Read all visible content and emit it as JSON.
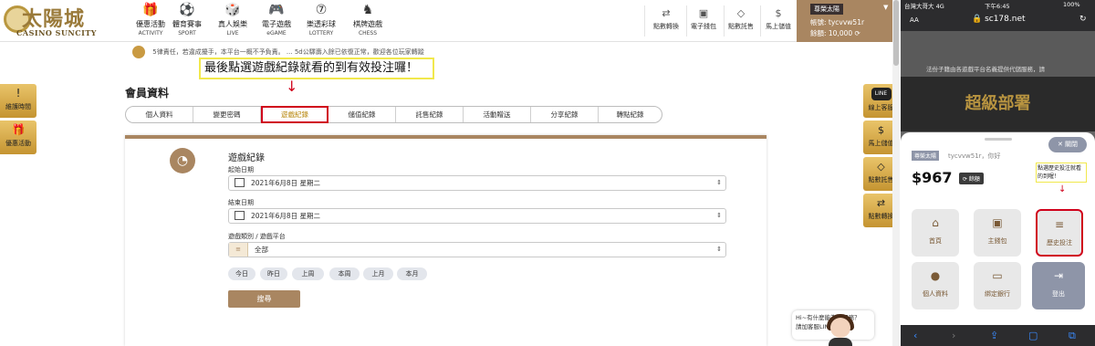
{
  "brand": {
    "name": "太陽城",
    "sub": "CASINO SUNCITY"
  },
  "nav": [
    {
      "icon": "gift-icon",
      "glyph": "🎁",
      "zh": "優惠活動",
      "en": "ACTIVITY"
    },
    {
      "icon": "soccer-icon",
      "glyph": "⚽",
      "zh": "體育賽事",
      "en": "SPORT"
    },
    {
      "icon": "dice-icon",
      "glyph": "🎲",
      "zh": "真人娛樂",
      "en": "LIVE"
    },
    {
      "icon": "gamepad-icon",
      "glyph": "🎮",
      "zh": "電子遊戲",
      "en": "eGAME"
    },
    {
      "icon": "lottery-ball-icon",
      "glyph": "⑦",
      "zh": "樂透彩球",
      "en": "LOTTERY"
    },
    {
      "icon": "chess-icon",
      "glyph": "♞",
      "zh": "棋牌遊戲",
      "en": "CHESS"
    }
  ],
  "wallet_nav": [
    {
      "icon": "transfer-icon",
      "glyph": "⇄",
      "label": "點數轉換"
    },
    {
      "icon": "wallet-icon",
      "glyph": "▣",
      "label": "電子錢包"
    },
    {
      "icon": "diamond-icon",
      "glyph": "◇",
      "label": "點數託售"
    },
    {
      "icon": "dollar-icon",
      "glyph": "$",
      "label": "馬上儲值"
    }
  ],
  "user": {
    "vip": "尊榮太陽",
    "account": "帳號: tycvvw51r",
    "balance": "餘額: 10,000 ⟳"
  },
  "marquee": "5律責任，若違成擾手，本平台一概不予負責。 ... 5d公驛壽入餘已依復正常，歡迎各位玩家轉蹤",
  "callout": "最後點選遊戲紀錄就看的到有效投注囉！",
  "arrow": "↓",
  "left_buttons": [
    {
      "icon": "alert-icon",
      "glyph": "!",
      "label": "維護時間"
    },
    {
      "icon": "gift-icon",
      "glyph": "🎁",
      "label": "優惠活動"
    }
  ],
  "member_title": "會員資料",
  "tabs": [
    "個人資料",
    "變更密碼",
    "遊戲紀錄",
    "儲值紀錄",
    "託售紀錄",
    "活動贈送",
    "分享紀錄",
    "轉點紀錄"
  ],
  "panel": {
    "title": "遊戲紀錄",
    "start_label": "起始日期",
    "start_value": "2021年6月8日 星期二",
    "end_label": "結束日期",
    "end_value": "2021年6月8日 星期二",
    "cat_label": "遊戲類別 / 遊戲平台",
    "cat_value": "全部",
    "quick": [
      "今日",
      "昨日",
      "上周",
      "本周",
      "上月",
      "本月"
    ],
    "search": "搜尋"
  },
  "right_buttons": [
    {
      "icon": "line-icon",
      "glyph": "LINE",
      "label": "線上客服"
    },
    {
      "icon": "dollar-icon",
      "glyph": "$",
      "label": "馬上儲值"
    },
    {
      "icon": "diamond-icon",
      "glyph": "◇",
      "label": "點數託售"
    },
    {
      "icon": "transfer-icon",
      "glyph": "⇄",
      "label": "點數轉換"
    }
  ],
  "chat": {
    "line1": "Hi~有什麼能為您服務？",
    "line2": "請加客服LINE:"
  },
  "phone": {
    "carrier": "台灣大哥大 4G",
    "time": "下午6:45",
    "battery": "100%",
    "aa": "AA",
    "url": "🔒 sc178.net",
    "page_notice": "法份子籍由各遊戲平台名義提供代儲服務，請",
    "page_banner": "超級部署",
    "vip": "尊榮太陽",
    "greeting": "tycvvw51r，你好",
    "close": "關閉",
    "balance": "$967",
    "refresh": "⟳ 餘額",
    "callout": "點選歷史投注就看的到喔！",
    "arrow": "↓",
    "tiles": [
      {
        "icon": "home-icon",
        "glyph": "⌂",
        "label": "首頁"
      },
      {
        "icon": "wallet-icon",
        "glyph": "▣",
        "label": "主錢包"
      },
      {
        "icon": "history-icon",
        "glyph": "≡",
        "label": "歷史投注"
      },
      {
        "icon": "user-icon",
        "glyph": "●",
        "label": "個人資料"
      },
      {
        "icon": "card-icon",
        "glyph": "▭",
        "label": "綁定銀行"
      },
      {
        "icon": "logout-icon",
        "glyph": "⇥",
        "label": "登出"
      }
    ]
  },
  "colors": {
    "accent": "#a98661",
    "gold": "#c59431",
    "highlight": "#d0021b",
    "callout_border": "#f1e84c"
  }
}
